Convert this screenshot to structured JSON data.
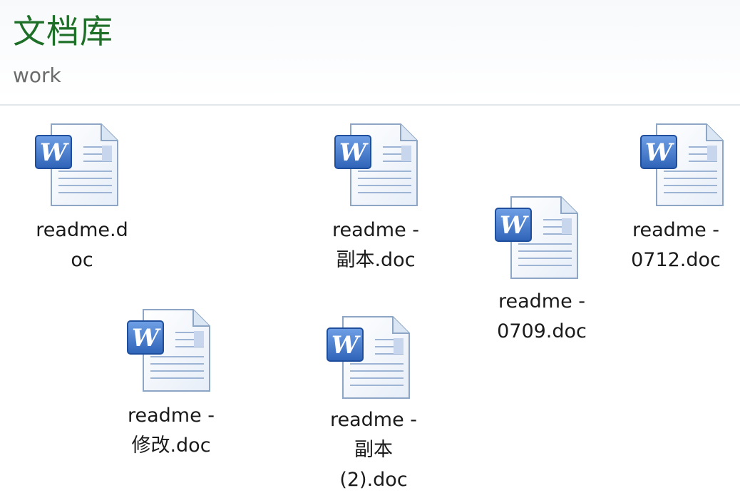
{
  "library": {
    "title": "文档库",
    "subtitle": "work"
  },
  "colors": {
    "title": "#1e6f28",
    "subtitle": "#6b6b6b",
    "label": "#1a1a1a",
    "word_icon_blue": "#2f63b8"
  },
  "files": [
    {
      "icon": "word-document-icon",
      "label_lines": [
        "readme.d",
        "oc"
      ]
    },
    {
      "icon": "word-document-icon",
      "label_lines": [
        "readme -",
        "副本.doc"
      ]
    },
    {
      "icon": "word-document-icon",
      "label_lines": [
        "readme -",
        "0709.doc"
      ]
    },
    {
      "icon": "word-document-icon",
      "label_lines": [
        "readme -",
        "0712.doc"
      ]
    },
    {
      "icon": "word-document-icon",
      "label_lines": [
        "readme -",
        "修改.doc"
      ]
    },
    {
      "icon": "word-document-icon",
      "label_lines": [
        "readme -",
        "副本",
        "(2).doc"
      ]
    }
  ]
}
